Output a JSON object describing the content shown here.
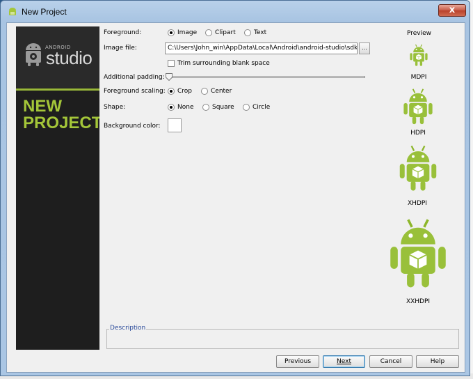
{
  "window": {
    "title": "New Project",
    "close": "x"
  },
  "sidebar": {
    "brand_small": "ANDROID",
    "brand_big": "studio",
    "heading_line1": "NEW",
    "heading_line2": "PROJECT"
  },
  "form": {
    "foreground_label": "Foreground:",
    "foreground_options": [
      "Image",
      "Clipart",
      "Text"
    ],
    "foreground_selected": "Image",
    "image_file_label": "Image file:",
    "image_file_value": "C:\\Users\\John_win\\AppData\\Local\\Android\\android-studio\\sdk\\tools",
    "browse_label": "...",
    "trim_label": "Trim surrounding blank space",
    "trim_checked": false,
    "padding_label": "Additional padding:",
    "padding_value": 0,
    "scaling_label": "Foreground scaling:",
    "scaling_options": [
      "Crop",
      "Center"
    ],
    "scaling_selected": "Crop",
    "shape_label": "Shape:",
    "shape_options": [
      "None",
      "Square",
      "Circle"
    ],
    "shape_selected": "None",
    "bgcolor_label": "Background color:",
    "bgcolor_value": "#ffffff"
  },
  "preview": {
    "title": "Preview",
    "densities": [
      "MDPI",
      "HDPI",
      "XHDPI",
      "XXHDPI"
    ]
  },
  "description": {
    "label": "Description"
  },
  "buttons": {
    "previous": "Previous",
    "next": "Next",
    "cancel": "Cancel",
    "help": "Help"
  },
  "colors": {
    "android_green": "#a4c639",
    "sidebar_bg": "#1e1e1e"
  }
}
